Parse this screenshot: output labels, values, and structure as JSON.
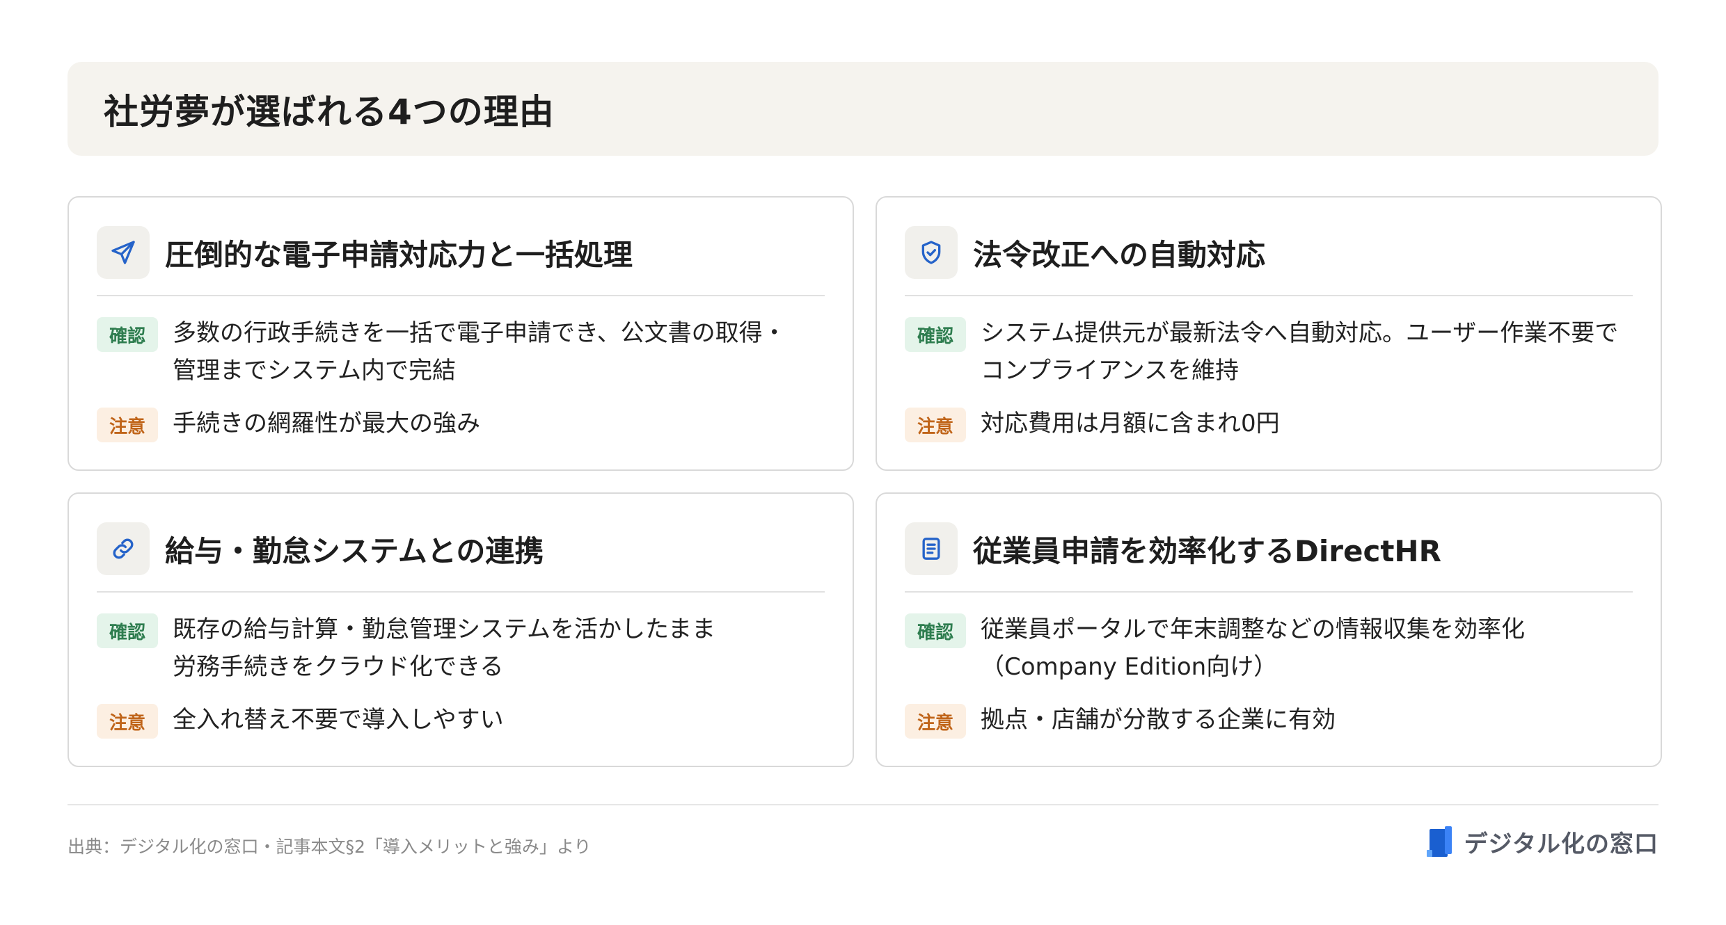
{
  "header": {
    "title": "社労夢が選ばれる4つの理由"
  },
  "cards": [
    {
      "icon": "send-icon",
      "title": "圧倒的な電子申請対応力と一括処理",
      "confirm_label": "確認",
      "confirm_text": "多数の行政手続きを一括で電子申請でき、公文書の取得・\n管理までシステム内で完結",
      "note_label": "注意",
      "note_text": "手続きの網羅性が最大の強み"
    },
    {
      "icon": "shield-check-icon",
      "title": "法令改正への自動対応",
      "confirm_label": "確認",
      "confirm_text": "システム提供元が最新法令へ自動対応。ユーザー作業不要で\nコンプライアンスを維持",
      "note_label": "注意",
      "note_text": "対応費用は月額に含まれ0円"
    },
    {
      "icon": "link-icon",
      "title": "給与・勤怠システムとの連携",
      "confirm_label": "確認",
      "confirm_text": "既存の給与計算・勤怠管理システムを活かしたまま\n労務手続きをクラウド化できる",
      "note_label": "注意",
      "note_text": "全入れ替え不要で導入しやすい"
    },
    {
      "icon": "document-icon",
      "title": "従業員申請を効率化するDirectHR",
      "confirm_label": "確認",
      "confirm_text": "従業員ポータルで年末調整などの情報収集を効率化\n（Company Edition向け）",
      "note_label": "注意",
      "note_text": "拠点・店舗が分散する企業に有効"
    }
  ],
  "footer": {
    "source": "出典：デジタル化の窓口・記事本文§2「導入メリットと強み」より",
    "brand": "デジタル化の窓口"
  },
  "colors": {
    "accent_blue": "#2563c9",
    "confirm_bg": "#e4f4ea",
    "confirm_fg": "#2e7d4f",
    "note_bg": "#fcefe2",
    "note_fg": "#c0651a",
    "title_bar_bg": "#f5f3ee"
  }
}
